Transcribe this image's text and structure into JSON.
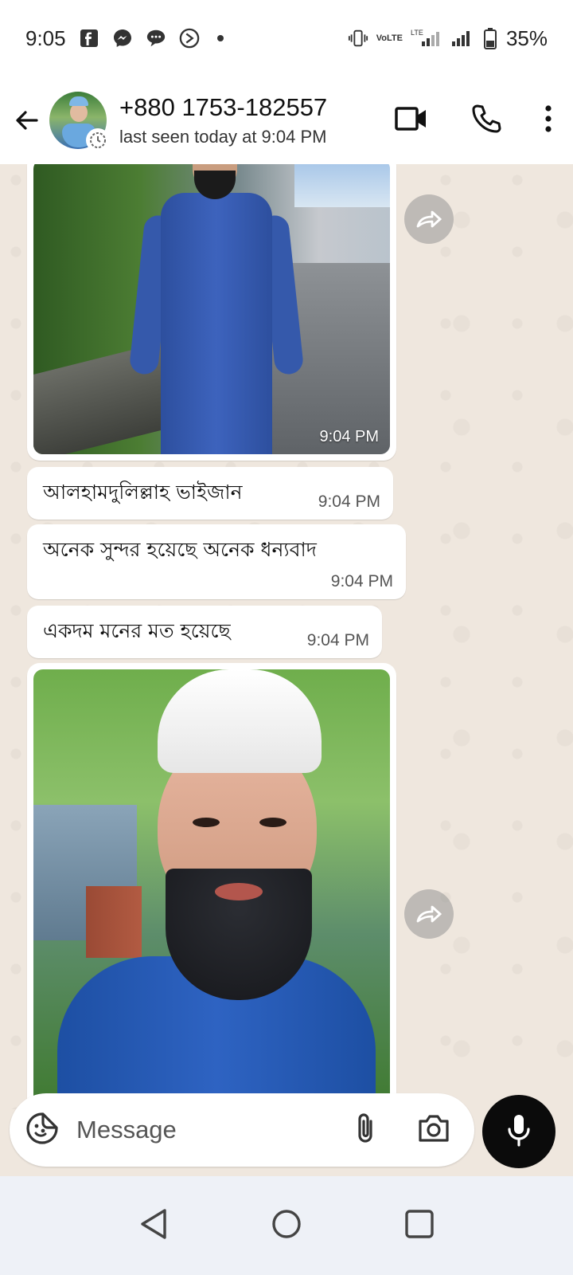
{
  "status_bar": {
    "time": "9:05",
    "battery": "35%",
    "network_label_1": "VoLTE",
    "network_label_2": "LTE"
  },
  "header": {
    "contact_name": "+880 1753-182557",
    "last_seen": "last seen today at 9:04 PM"
  },
  "messages": [
    {
      "type": "image",
      "time": "9:04 PM",
      "description_icon": "photo"
    },
    {
      "type": "text",
      "text": "আলহামদুলিল্লাহ ভাইজান",
      "time": "9:04 PM"
    },
    {
      "type": "text",
      "text": "অনেক সুন্দর হয়েছে অনেক ধন্যবাদ",
      "time": "9:04 PM"
    },
    {
      "type": "text",
      "text": "একদম মনের মত হয়েছে",
      "time": "9:04 PM"
    },
    {
      "type": "image",
      "time": "",
      "description_icon": "photo"
    }
  ],
  "composer": {
    "placeholder": "Message"
  },
  "colors": {
    "chat_background": "#efe7de",
    "bubble": "#ffffff",
    "mic_button": "#0b0b0b",
    "header_bg": "#ffffff"
  }
}
